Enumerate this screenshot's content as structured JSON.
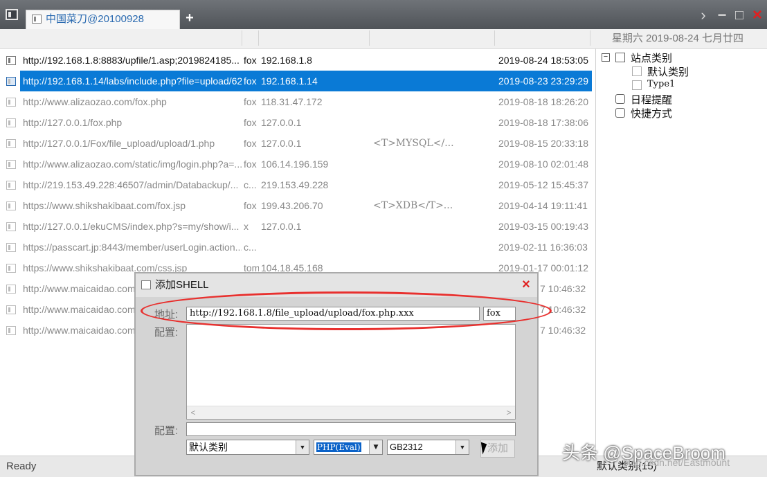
{
  "window": {
    "tab_title": "中国菜刀@20100928",
    "new_tab": "+",
    "date_info": "星期六 2019-08-24 七月廿四"
  },
  "window_controls": {
    "next": "›",
    "minimize": "−",
    "maximize": "□",
    "close": "×"
  },
  "list": {
    "rows": [
      {
        "url": "http://192.168.1.8:8883/upfile/1.asp;2019824185...",
        "tag": "fox",
        "ip": "192.168.1.8",
        "note": "",
        "time": "2019-08-24 18:53:05"
      },
      {
        "url": "http://192.168.1.14/labs/include.php?file=upload/62",
        "tag": "fox",
        "ip": "192.168.1.14",
        "note": "",
        "time": "2019-08-23 23:29:29"
      },
      {
        "url": "http://www.alizaozao.com/fox.php",
        "tag": "fox",
        "ip": "118.31.47.172",
        "note": "",
        "time": "2019-08-18 18:26:20"
      },
      {
        "url": "http://127.0.0.1/fox.php",
        "tag": "fox",
        "ip": "127.0.0.1",
        "note": "",
        "time": "2019-08-18 17:38:06"
      },
      {
        "url": "http://127.0.0.1/Fox/file_upload/upload/1.php",
        "tag": "fox",
        "ip": "127.0.0.1",
        "note": "<T>MYSQL</...",
        "time": "2019-08-15 20:33:18"
      },
      {
        "url": "http://www.alizaozao.com/static/img/login.php?a=...",
        "tag": "fox",
        "ip": "106.14.196.159",
        "note": "",
        "time": "2019-08-10 02:01:48"
      },
      {
        "url": "http://219.153.49.228:46507/admin/Databackup/...",
        "tag": "c...",
        "ip": "219.153.49.228",
        "note": "",
        "time": "2019-05-12 15:45:37"
      },
      {
        "url": "https://www.shikshakibaat.com/fox.jsp",
        "tag": "fox",
        "ip": "199.43.206.70",
        "note": "<T>XDB</T>...",
        "time": "2019-04-14 19:11:41"
      },
      {
        "url": "http://127.0.0.1/ekuCMS/index.php?s=my/show/i...",
        "tag": "x",
        "ip": "127.0.0.1",
        "note": "",
        "time": "2019-03-15 00:19:43"
      },
      {
        "url": "https://passcart.jp:8443/member/userLogin.action...",
        "tag": "c...",
        "ip": "",
        "note": "",
        "time": "2019-02-11 16:36:03"
      },
      {
        "url": "https://www.shikshakibaat.com/css.jsp",
        "tag": "tom",
        "ip": "104.18.45.168",
        "note": "",
        "time": "2019-01-17 00:01:12"
      },
      {
        "url": "http://www.maicaidao.com",
        "tag": "",
        "ip": "",
        "note": "",
        "time": "7 10:46:32"
      },
      {
        "url": "http://www.maicaidao.com",
        "tag": "",
        "ip": "",
        "note": "",
        "time": "7 10:46:32"
      },
      {
        "url": "http://www.maicaidao.com",
        "tag": "",
        "ip": "",
        "note": "",
        "time": "7 10:46:32"
      }
    ]
  },
  "tree": {
    "root": "站点类别",
    "children": [
      "默认类别",
      "Type1"
    ],
    "schedule": "日程提醒",
    "shortcuts": "快捷方式",
    "collapse_symbol": "−"
  },
  "dialog": {
    "title": "添加SHELL",
    "close": "×",
    "address_label": "地址:",
    "address_value": "http://192.168.1.8/file_upload/upload/fox.php.xxx",
    "password_value": "fox",
    "config_label": "配置:",
    "config_label2": "配置:",
    "scroll_left": "<",
    "scroll_right": ">",
    "category_select": "默认类别",
    "type_select": "PHP(Eval)",
    "encoding_select": "GB2312",
    "add_button": "添加"
  },
  "status": {
    "text": "Ready",
    "right": "默认类别(15)"
  },
  "watermark": {
    "main": "头条 @SpaceBroom",
    "sub": "blog.csdn.net/Eastmount"
  },
  "colors": {
    "selection": "#0a7ad6",
    "annotation": "#e8302e",
    "tab_text": "#2a6ab0"
  }
}
